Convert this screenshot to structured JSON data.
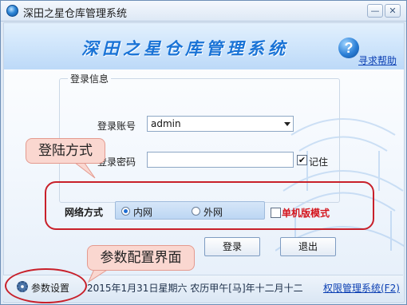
{
  "window": {
    "title": "深田之星仓库管理系统",
    "minimize_glyph": "—",
    "close_glyph": "✕"
  },
  "banner": {
    "title": "深田之星仓库管理系统",
    "help_icon_glyph": "?",
    "help_link": "寻求帮助"
  },
  "login": {
    "group_title": "登录信息",
    "account_label": "登录账号",
    "account_value": "admin",
    "password_label": "登录密码",
    "password_value": "",
    "remember_label": "记住",
    "remember_checked": true,
    "remember_glyph": "✔"
  },
  "network": {
    "label": "网络方式",
    "options": [
      {
        "label": "内网",
        "selected": true
      },
      {
        "label": "外网",
        "selected": false
      }
    ],
    "single_mode_label": "单机版模式",
    "single_mode_checked": false
  },
  "buttons": {
    "login": "登录",
    "exit": "退出"
  },
  "statusbar": {
    "settings_label": "参数设置",
    "date_text": "2015年1月31日星期六 农历甲午[马]年十二月十二",
    "permission_link": "权限管理系统(F2)"
  },
  "annotations": {
    "login_mode_callout": "登陆方式",
    "settings_callout": "参数配置界面"
  },
  "colors": {
    "accent": "#1973d6",
    "annotation_red": "#c8202a",
    "callout_fill": "#fad7d0",
    "link_blue": "#0b3fb3"
  }
}
